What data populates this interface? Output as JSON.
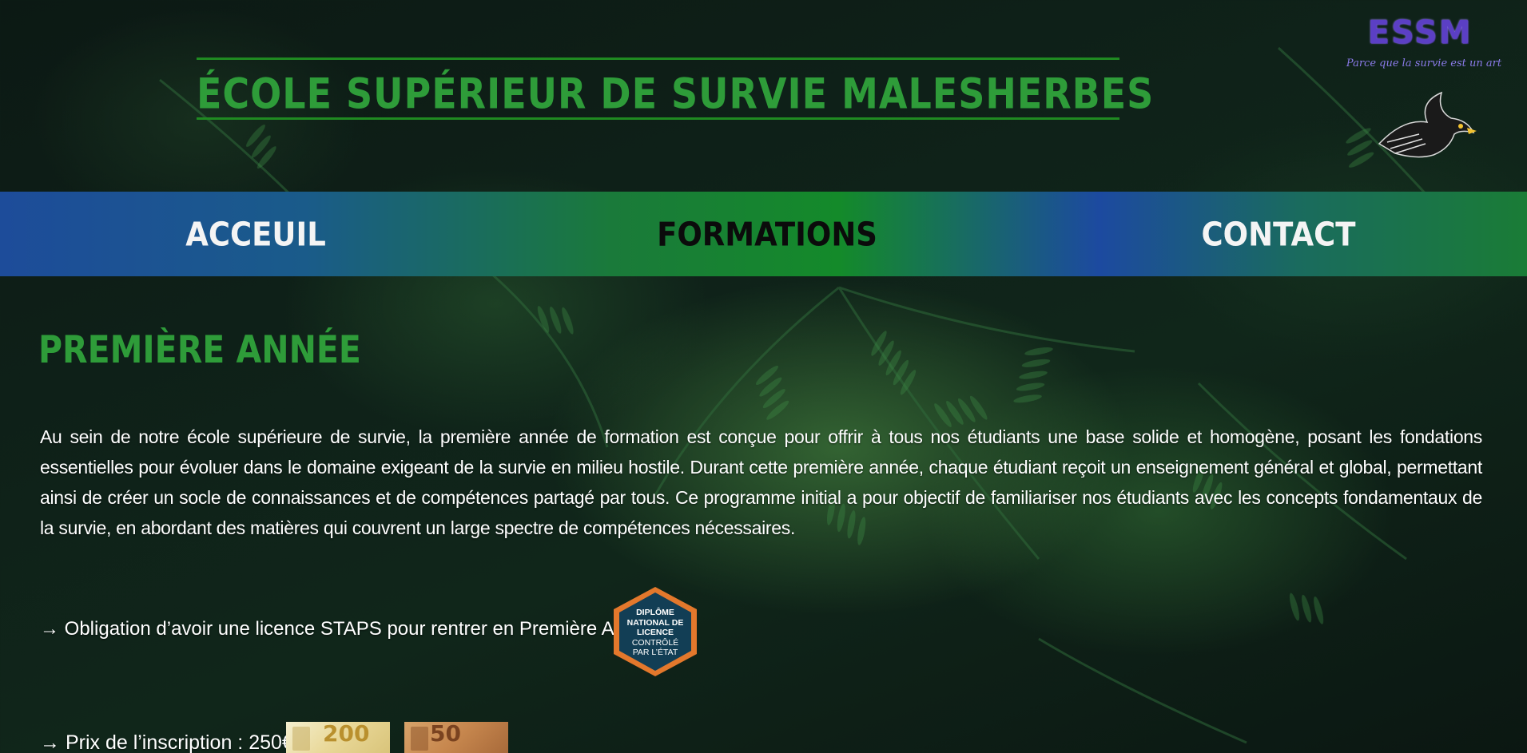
{
  "header": {
    "site_title": "École Supérieur de survie Malesherbes",
    "logo": {
      "name": "ESSM",
      "tagline": "Parce que la survie est un art",
      "emblem_icon": "eagle-emblem-icon",
      "primary_color": "#5b3fc4"
    }
  },
  "nav": {
    "items": [
      {
        "label": "Acceuil",
        "active": false
      },
      {
        "label": "Formations",
        "active": true
      },
      {
        "label": "Contact",
        "active": false
      }
    ]
  },
  "main": {
    "section_title": "Première Année",
    "intro": "Au sein de notre école supérieure de survie, la première année de formation est conçue pour offrir à tous nos étudiants une base solide et homogène, posant les fondations essentielles pour évoluer dans le domaine exigeant de la survie en milieu hostile. Durant cette première année, chaque étudiant reçoit un enseignement général et global, permettant ainsi de créer un socle de connaissances et de compétences partagé par tous. Ce programme initial a pour objectif de familiariser nos étudiants avec les concepts fondamentaux de la survie, en abordant des matières qui couvrent un large spectre de compétences nécessaires.",
    "requirement": "→ Obligation d’avoir une licence STAPS pour rentrer en Première Année",
    "badge": {
      "line1": "DIPLÔME",
      "line2": "NATIONAL DE",
      "line3": "LICENCE",
      "line4": "CONTRÔLÉ",
      "line5": "PAR L’ÉTAT"
    },
    "price": "→ Prix de l’inscription : 250€",
    "banknotes": [
      {
        "value": "200"
      },
      {
        "value": "50"
      }
    ]
  },
  "colors": {
    "title_green": "#2e9c39",
    "nav_blue": "#1d4c9a",
    "nav_green": "#148a2a"
  }
}
